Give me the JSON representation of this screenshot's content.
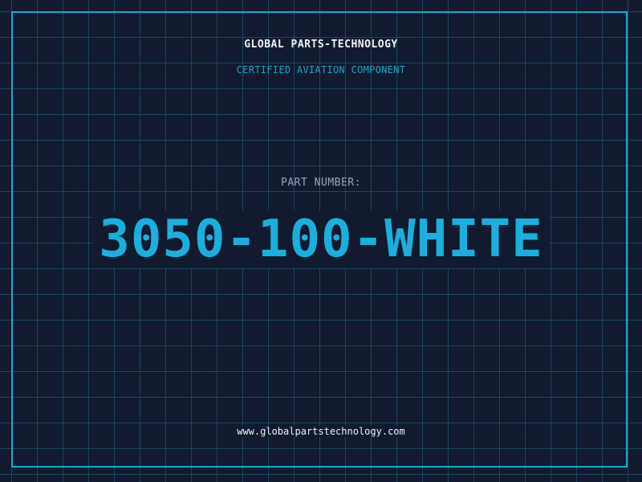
{
  "header": {
    "brand": "GLOBAL PARTS-TECHNOLOGY",
    "subtitle": "CERTIFIED AVIATION COMPONENT"
  },
  "part": {
    "label": "PART NUMBER:",
    "number": "3050-100-WHITE"
  },
  "footer": {
    "website": "www.globalpartstechnology.com"
  },
  "colors": {
    "background": "#111a2e",
    "grid": "#266e8c",
    "accent": "#1ab0dc",
    "text": "#f2f4f8",
    "muted": "#9ba6bd"
  }
}
